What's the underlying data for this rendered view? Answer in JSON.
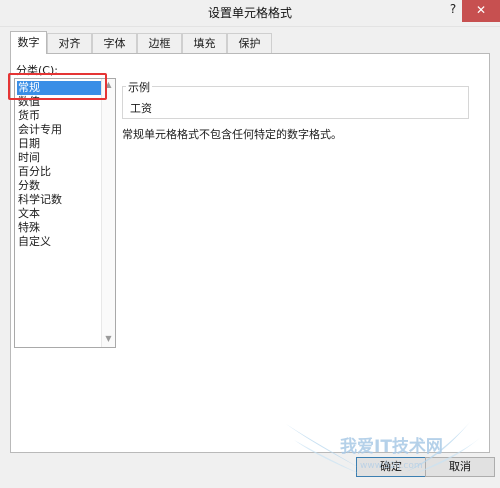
{
  "window": {
    "title": "设置单元格格式",
    "help": "?",
    "close": "✕"
  },
  "tabs": [
    "数字",
    "对齐",
    "字体",
    "边框",
    "填充",
    "保护"
  ],
  "category": {
    "label": "分类(C):",
    "items": [
      "常规",
      "数值",
      "货币",
      "会计专用",
      "日期",
      "时间",
      "百分比",
      "分数",
      "科学记数",
      "文本",
      "特殊",
      "自定义"
    ],
    "selected": "常规"
  },
  "sample": {
    "legend": "示例",
    "value": "工资"
  },
  "description": "常规单元格格式不包含任何特定的数字格式。",
  "buttons": {
    "ok": "确定",
    "cancel": "取消"
  },
  "watermark": {
    "text": "我爱IT技术网",
    "url": "www.52ij.com"
  },
  "colors": {
    "selection": "#3a8ee6",
    "highlight_box": "#e53535",
    "close_button": "#c75050"
  }
}
